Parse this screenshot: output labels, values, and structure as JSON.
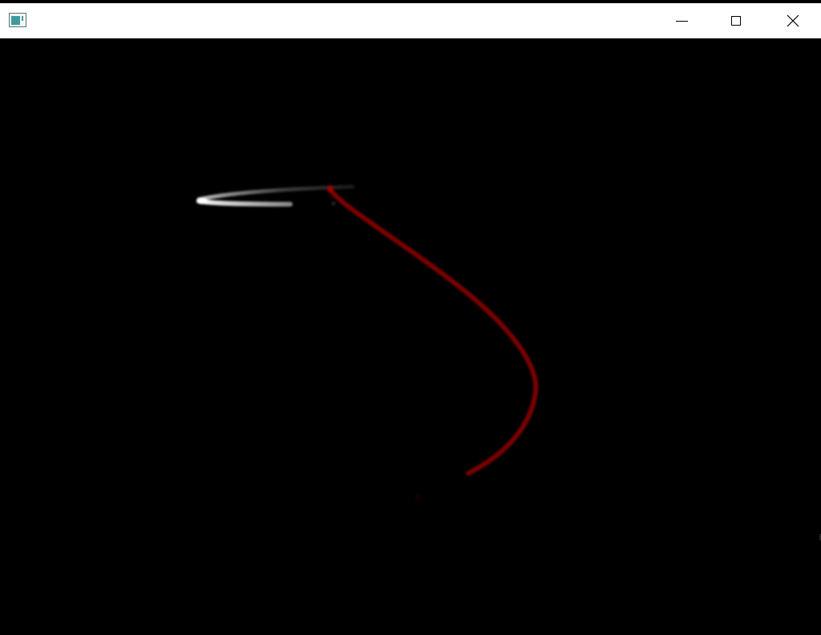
{
  "window": {
    "title": "",
    "icon": "app-window-icon",
    "controls": {
      "minimize_icon": "minimize-icon",
      "maximize_icon": "maximize-icon",
      "close_icon": "close-icon"
    }
  },
  "scene": {
    "background_color": "#000000",
    "trails": [
      {
        "name": "white-trail",
        "color": "#ffffff"
      },
      {
        "name": "red-trail",
        "color": "#8b0000"
      }
    ]
  }
}
